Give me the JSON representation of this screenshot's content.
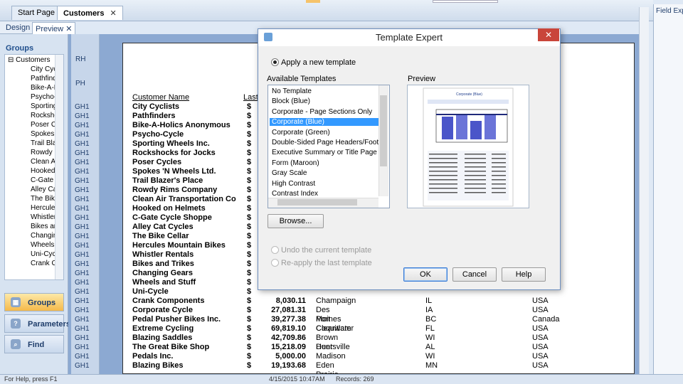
{
  "doc_tabs": {
    "start_page": "Start Page",
    "customers": "Customers",
    "close": "✕"
  },
  "sub_tabs": {
    "design": "Design",
    "preview": "Preview",
    "close": "✕"
  },
  "groups_panel": {
    "title": "Groups",
    "root": "Customers",
    "items": [
      "City Cyc",
      "Pathfind",
      "Bike-A-H",
      "Psycho-",
      "Sporting",
      "Rocksho",
      "Poser Cy",
      "Spokes",
      "Trail Bla",
      "Rowdy R",
      "Clean Ai",
      "Hooked",
      "C-Gate C",
      "Alley Ca",
      "The Bik",
      "Hercule",
      "Whistler",
      "Bikes ar",
      "Changin",
      "Wheels",
      "Uni-Cycl",
      "Crank C"
    ],
    "nav": [
      "Groups",
      "Parameters",
      "Find"
    ]
  },
  "bands": {
    "rh": "RH",
    "ph": "PH",
    "gh": "GH1"
  },
  "report": {
    "col_customer": "Customer Name",
    "col_last": "Last",
    "rows": [
      {
        "name": "City Cyclists",
        "amt": "",
        "city": "",
        "state": "",
        "country": ""
      },
      {
        "name": "Pathfinders",
        "amt": "",
        "city": "",
        "state": "",
        "country": ""
      },
      {
        "name": "Bike-A-Holics Anonymous",
        "amt": "",
        "city": "",
        "state": "",
        "country": ""
      },
      {
        "name": "Psycho-Cycle",
        "amt": "",
        "city": "",
        "state": "",
        "country": ""
      },
      {
        "name": "Sporting Wheels Inc.",
        "amt": "",
        "city": "",
        "state": "",
        "country": ""
      },
      {
        "name": "Rockshocks for Jocks",
        "amt": "",
        "city": "",
        "state": "",
        "country": ""
      },
      {
        "name": "Poser Cycles",
        "amt": "",
        "city": "",
        "state": "",
        "country": ""
      },
      {
        "name": "Spokes 'N Wheels Ltd.",
        "amt": "",
        "city": "",
        "state": "",
        "country": ""
      },
      {
        "name": "Trail Blazer's Place",
        "amt": "",
        "city": "",
        "state": "",
        "country": ""
      },
      {
        "name": "Rowdy Rims Company",
        "amt": "",
        "city": "",
        "state": "",
        "country": ""
      },
      {
        "name": "Clean Air Transportation Co.",
        "amt": "",
        "city": "",
        "state": "",
        "country": ""
      },
      {
        "name": "Hooked on Helmets",
        "amt": "",
        "city": "",
        "state": "",
        "country": ""
      },
      {
        "name": "C-Gate Cycle Shoppe",
        "amt": "",
        "city": "",
        "state": "",
        "country": ""
      },
      {
        "name": "Alley Cat Cycles",
        "amt": "",
        "city": "",
        "state": "",
        "country": ""
      },
      {
        "name": "The Bike Cellar",
        "amt": "",
        "city": "",
        "state": "",
        "country": ""
      },
      {
        "name": "Hercules Mountain Bikes",
        "amt": "",
        "city": "",
        "state": "",
        "country": ""
      },
      {
        "name": "Whistler Rentals",
        "amt": "",
        "city": "",
        "state": "",
        "country": ""
      },
      {
        "name": "Bikes and Trikes",
        "amt": "",
        "city": "",
        "state": "",
        "country": ""
      },
      {
        "name": "Changing Gears",
        "amt": "",
        "city": "",
        "state": "",
        "country": ""
      },
      {
        "name": "Wheels and Stuff",
        "amt": "",
        "city": "",
        "state": "",
        "country": ""
      },
      {
        "name": "Uni-Cycle",
        "amt": "",
        "city": "",
        "state": "",
        "country": ""
      },
      {
        "name": "Crank Components",
        "amt": "8,030.11",
        "city": "Champaign",
        "state": "IL",
        "country": "USA"
      },
      {
        "name": "Corporate Cycle",
        "amt": "27,081.31",
        "city": "Des Moines",
        "state": "IA",
        "country": "USA"
      },
      {
        "name": "Pedal Pusher Bikes Inc.",
        "amt": "39,277.38",
        "city": "Port Coquitlam",
        "state": "BC",
        "country": "Canada"
      },
      {
        "name": "Extreme Cycling",
        "amt": "69,819.10",
        "city": "Clearwater",
        "state": "FL",
        "country": "USA"
      },
      {
        "name": "Blazing Saddles",
        "amt": "42,709.86",
        "city": "Brown Deer",
        "state": "WI",
        "country": "USA"
      },
      {
        "name": "The Great Bike Shop",
        "amt": "15,218.09",
        "city": "Huntsville",
        "state": "AL",
        "country": "USA"
      },
      {
        "name": "Pedals Inc.",
        "amt": "5,000.00",
        "city": "Madison",
        "state": "WI",
        "country": "USA"
      },
      {
        "name": "Blazing Bikes",
        "amt": "19,193.68",
        "city": "Eden Prairie",
        "state": "MN",
        "country": "USA"
      }
    ]
  },
  "field_explorer": {
    "title": "Field Exp"
  },
  "status": {
    "help": "For Help, press F1",
    "date": "4/15/2015 10:47AM",
    "records": "Records: 269"
  },
  "dialog": {
    "title": "Template Expert",
    "close": "✕",
    "apply_new": "Apply a new template",
    "available_label": "Available Templates",
    "preview_label": "Preview",
    "templates": [
      "No Template",
      "Block (Blue)",
      "Corporate - Page Sections Only",
      "Corporate (Blue)",
      "Corporate (Green)",
      "Double-Sided Page Headers/Footers",
      "Executive Summary or Title Page",
      "Form (Maroon)",
      "Gray Scale",
      "High Contrast",
      "Contrast Index"
    ],
    "selected_index": 3,
    "browse": "Browse...",
    "undo": "Undo the current template",
    "reapply": "Re-apply the last template",
    "ok": "OK",
    "cancel": "Cancel",
    "help": "Help",
    "preview_title": "Corporate (Blue)"
  }
}
